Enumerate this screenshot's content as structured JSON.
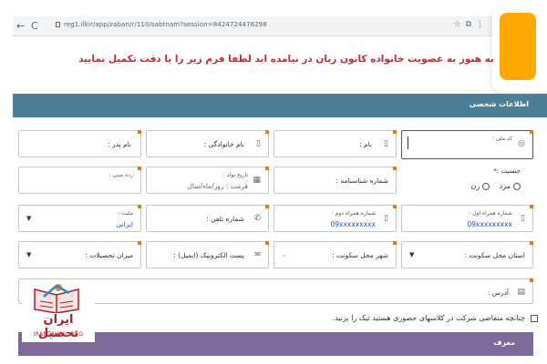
{
  "browser": {
    "url": "reg1.ilkir/app/zaban/r/110/sabtnam?session=8424724476298",
    "nav_back": "←",
    "nav_reload": "C"
  },
  "warning": "به هنوز به عضویت خانواده کانون زبان در نیامده اید لطفا فرم زیر را با دقت تکمیل نمایید",
  "sections": {
    "personal": {
      "title": "اطلاعات شخصی",
      "color": "#4a7f96"
    },
    "referrer": {
      "title": "معرف",
      "color": "#7e6a99"
    }
  },
  "fields": {
    "national_code": {
      "label": "کد ملی :"
    },
    "first_name": {
      "label": "نام :"
    },
    "last_name": {
      "label": "نام خانوادگی :"
    },
    "father_name": {
      "label": "نام پدر :"
    },
    "gender": {
      "label": "جنسیت :",
      "required_mark": "*",
      "options": [
        "مرد",
        "زن"
      ]
    },
    "id_number": {
      "label": "شماره شناسنامه :"
    },
    "birth_date": {
      "label": "تاریخ تولد :",
      "placeholder": "فرمت : روز/ماه/سال"
    },
    "english_name": {
      "label": "رده سنی :"
    },
    "mobile1": {
      "label": "شماره همراه اول :",
      "value": "09xxxxxxxxx"
    },
    "mobile2": {
      "label": "شماره همراه دوم :",
      "value": "09xxxxxxxxx"
    },
    "phone": {
      "label": "شماره تلفن :"
    },
    "nationality": {
      "label": "ملیت :",
      "value": "ایرانی"
    },
    "province": {
      "label": "استان محل سکونت :"
    },
    "city": {
      "label": "شهر محل سکونت :"
    },
    "email": {
      "label": "پست الکترونیک (ایمیل) :"
    },
    "education": {
      "label": "میزان تحصیلات :"
    },
    "address": {
      "label": "آدرس :"
    }
  },
  "checkbox": {
    "label": "چنانچه متقاضی شرکت در کلاسهای حضوری هستید تیک را بزنید."
  },
  "logo": {
    "name": "ایران تحصیل",
    "site": "IRANTAHSIL.ORG"
  },
  "colors": {
    "badge": "#ffa800",
    "warning": "#d6242a",
    "accent_corner": "#e07a1f",
    "value_blue": "#2452c4"
  }
}
